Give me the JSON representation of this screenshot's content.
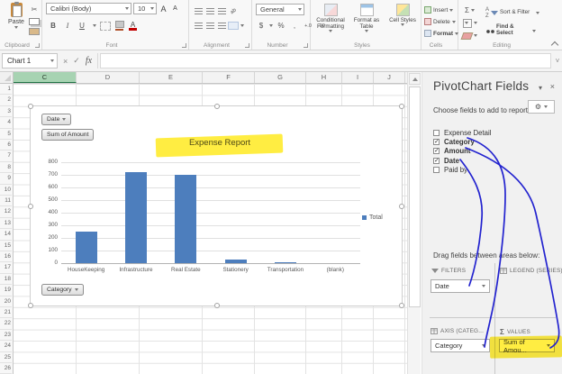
{
  "icons": {
    "dropdown": "▾",
    "gear": "⚙",
    "close": "×",
    "check": "✓",
    "cancel": "×",
    "fx": "fx",
    "sigma": "Σ",
    "scissors": "✂",
    "expand": "˅",
    "bold": "B",
    "italic": "I",
    "underline": "U",
    "font_color": "A",
    "dollar": "$",
    "percent": "%",
    "comma": ","
  },
  "ribbon": {
    "paste_label": "Paste",
    "font_name": "Calibri (Body)",
    "font_size": "10",
    "grow_font": "A",
    "shrink_font": "A",
    "number_format": "General",
    "groups": [
      "Clipboard",
      "Font",
      "Alignment",
      "Number",
      "Styles",
      "Cells",
      "Editing"
    ],
    "styles_buttons": [
      "Conditional Formatting",
      "Format as Table",
      "Cell Styles"
    ],
    "cells_buttons": [
      "Insert",
      "Delete",
      "Format"
    ],
    "editing_buttons": [
      "Sort & Filter",
      "Find & Select"
    ]
  },
  "formula_bar": {
    "name_box": "Chart 1"
  },
  "sheet": {
    "columns": [
      {
        "label": "C",
        "width": 70,
        "selected": true
      },
      {
        "label": "D",
        "width": 70,
        "selected": false
      },
      {
        "label": "E",
        "width": 70,
        "selected": false
      },
      {
        "label": "F",
        "width": 58,
        "selected": false
      },
      {
        "label": "G",
        "width": 57,
        "selected": false
      },
      {
        "label": "H",
        "width": 40,
        "selected": false
      },
      {
        "label": "I",
        "width": 35,
        "selected": false
      },
      {
        "label": "J",
        "width": 35,
        "selected": false
      }
    ],
    "rows": [
      "1",
      "2",
      "3",
      "4",
      "5",
      "6",
      "7",
      "8",
      "9",
      "10",
      "11",
      "12",
      "13",
      "14",
      "15",
      "16",
      "17",
      "18",
      "19",
      "20",
      "21",
      "22",
      "23",
      "24",
      "25",
      "26"
    ]
  },
  "chart": {
    "date_button": "Date",
    "sum_button": "Sum of Amount",
    "category_button": "Category",
    "title": "Expense Report",
    "legend": "Total",
    "bar_color": "#4d7ebd"
  },
  "chart_data": {
    "type": "bar",
    "title": "Expense Report",
    "categories": [
      "HouseKeeping",
      "Infrastructure",
      "Real Estate",
      "Stationery",
      "Transportation",
      "(blank)"
    ],
    "values": [
      250,
      720,
      700,
      30,
      10,
      0
    ],
    "series": [
      {
        "name": "Total",
        "values": [
          250,
          720,
          700,
          30,
          10,
          0
        ]
      }
    ],
    "xlabel": "Category",
    "ylabel": "Sum of Amount",
    "ylim": [
      0,
      800
    ],
    "ytick_step": 100,
    "grid": true,
    "legend_position": "right"
  },
  "panel": {
    "title": "PivotChart Fields",
    "choose_label": "Choose fields to add to report:",
    "fields": [
      {
        "label": "Expense Detail",
        "checked": false
      },
      {
        "label": "Category",
        "checked": true
      },
      {
        "label": "Amount",
        "checked": true
      },
      {
        "label": "Date",
        "checked": true
      },
      {
        "label": "Paid by",
        "checked": false
      }
    ],
    "drag_label": "Drag fields between areas below:",
    "areas": {
      "filters": {
        "label": "FILTERS",
        "item": "Date"
      },
      "legend": {
        "label": "LEGEND (SERIES)",
        "item": ""
      },
      "axis": {
        "label": "AXIS (CATEG...",
        "item": "Category"
      },
      "values": {
        "label": "VALUES",
        "item": "Sum of Amou...",
        "highlighted": true
      }
    },
    "annotation_color": "#2323cf",
    "highlight_color": "#ffe912"
  }
}
